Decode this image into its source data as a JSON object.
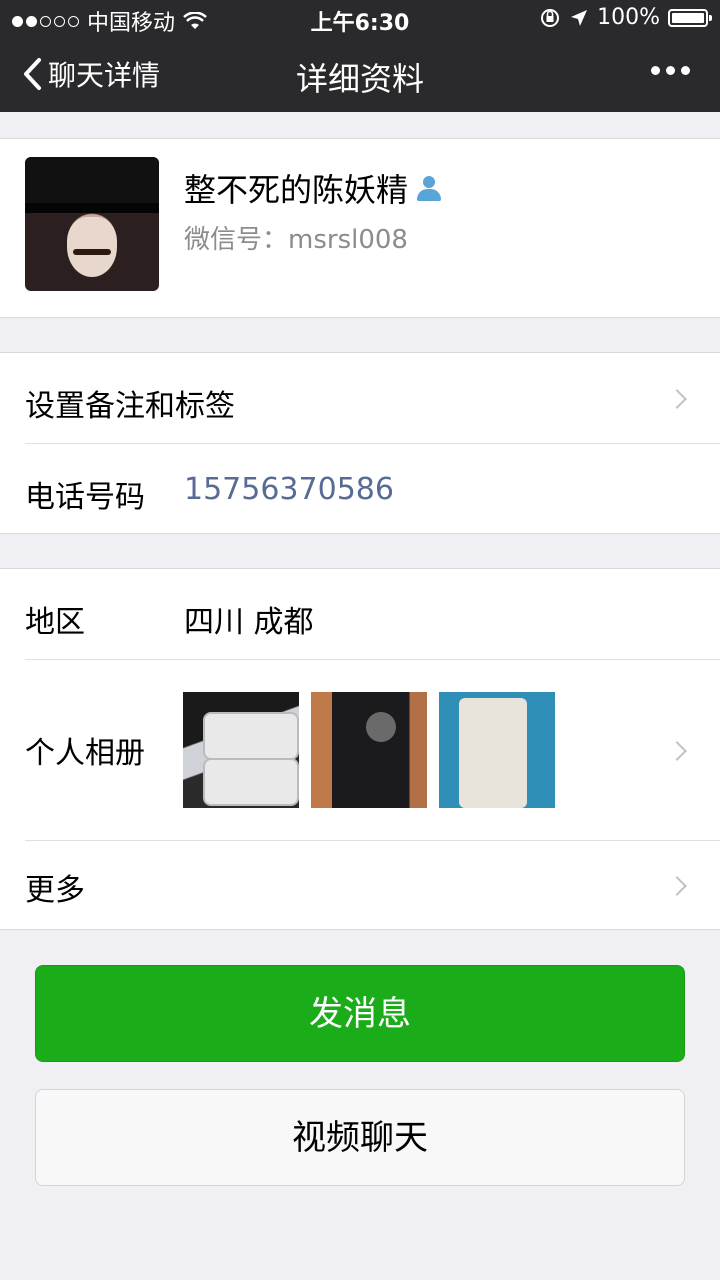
{
  "status_bar": {
    "carrier": "中国移动",
    "time": "上午6:30",
    "battery": "100%",
    "battery_level": 1.0,
    "signal_filled": 2,
    "signal_total": 5
  },
  "nav": {
    "back_label": "聊天详情",
    "title": "详细资料"
  },
  "profile": {
    "name": "整不死的陈妖精",
    "wechat_id": "微信号：msrsl008"
  },
  "rows": {
    "remark": {
      "label": "设置备注和标签"
    },
    "phone": {
      "label": "电话号码",
      "value": "15756370586"
    },
    "region": {
      "label": "地区",
      "value": "四川 成都"
    },
    "album": {
      "label": "个人相册"
    },
    "more": {
      "label": "更多"
    }
  },
  "buttons": {
    "message": "发消息",
    "video_chat": "视频聊天"
  },
  "colors": {
    "nav_bg": "#2a2a2c",
    "primary_green": "#1aad19",
    "phone_link": "#576b95",
    "page_bg": "#efeff4"
  }
}
